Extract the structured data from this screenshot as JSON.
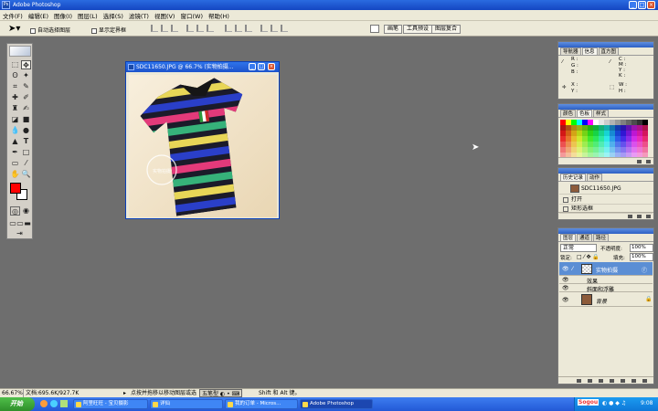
{
  "window": {
    "title": "Adobe Photoshop",
    "app_icon": "Ps"
  },
  "menubar": [
    "文件(F)",
    "编辑(E)",
    "图像(I)",
    "图层(L)",
    "选择(S)",
    "滤镜(T)",
    "视图(V)",
    "窗口(W)",
    "帮助(H)"
  ],
  "options_bar": {
    "auto_select_label": "自动选择图层",
    "show_bounds_label": "显示定界框",
    "dock_tabs": [
      "画笔",
      "工具预设",
      "图层复合"
    ]
  },
  "document": {
    "title": "SDC11650.JPG @ 66.7% (实物拍摄...",
    "watermark": "实物拍摄"
  },
  "panels": {
    "info": {
      "tabs": [
        "导航器",
        "信息",
        "直方图"
      ],
      "cells": {
        "rgb": [
          "R :",
          "G :",
          "B :"
        ],
        "cmyk": [
          "C :",
          "M :",
          "Y :",
          "K :"
        ],
        "xy": [
          "X :",
          "Y :"
        ],
        "wh": [
          "W :",
          "H :"
        ]
      }
    },
    "swatches": {
      "tabs": [
        "颜色",
        "色板",
        "样式"
      ]
    },
    "history": {
      "tabs": [
        "历史记录",
        "动作"
      ],
      "snapshot": "SDC11650.JPG",
      "steps": [
        "打开",
        "矩形选框"
      ]
    },
    "layers": {
      "tabs": [
        "图层",
        "通道",
        "路径"
      ],
      "blend_mode": "正常",
      "opacity_label": "不透明度:",
      "opacity_value": "100%",
      "lock_label": "锁定:",
      "fill_label": "填充:",
      "fill_value": "100%",
      "items": [
        {
          "name": "实物拍摄",
          "selected": true
        },
        {
          "name": "效果",
          "selected": false
        },
        {
          "name": "斜面和浮雕",
          "selected": false
        },
        {
          "name": "背景",
          "selected": false
        }
      ]
    }
  },
  "statusbar": {
    "zoom": "66.67%",
    "doc": "文档:695.6K/927.7K",
    "hint_prefix": "点按并拖移以移动图层或选",
    "ime": "五笔型",
    "hint_suffix": "Shift 和 Alt 键。"
  },
  "taskbar": {
    "start_label": "开始",
    "tasks": [
      "阿里旺旺 - 宝贝摄影",
      "详仙",
      "我的订单 - Micros...",
      "Adobe Photoshop"
    ],
    "clock": "9:08",
    "tray_brand": "Sogou"
  },
  "colors": {
    "foreground": "#ff0000",
    "background": "#ffffff",
    "xp_blue": "#2359d6",
    "workspace": "#6e6e6e"
  }
}
